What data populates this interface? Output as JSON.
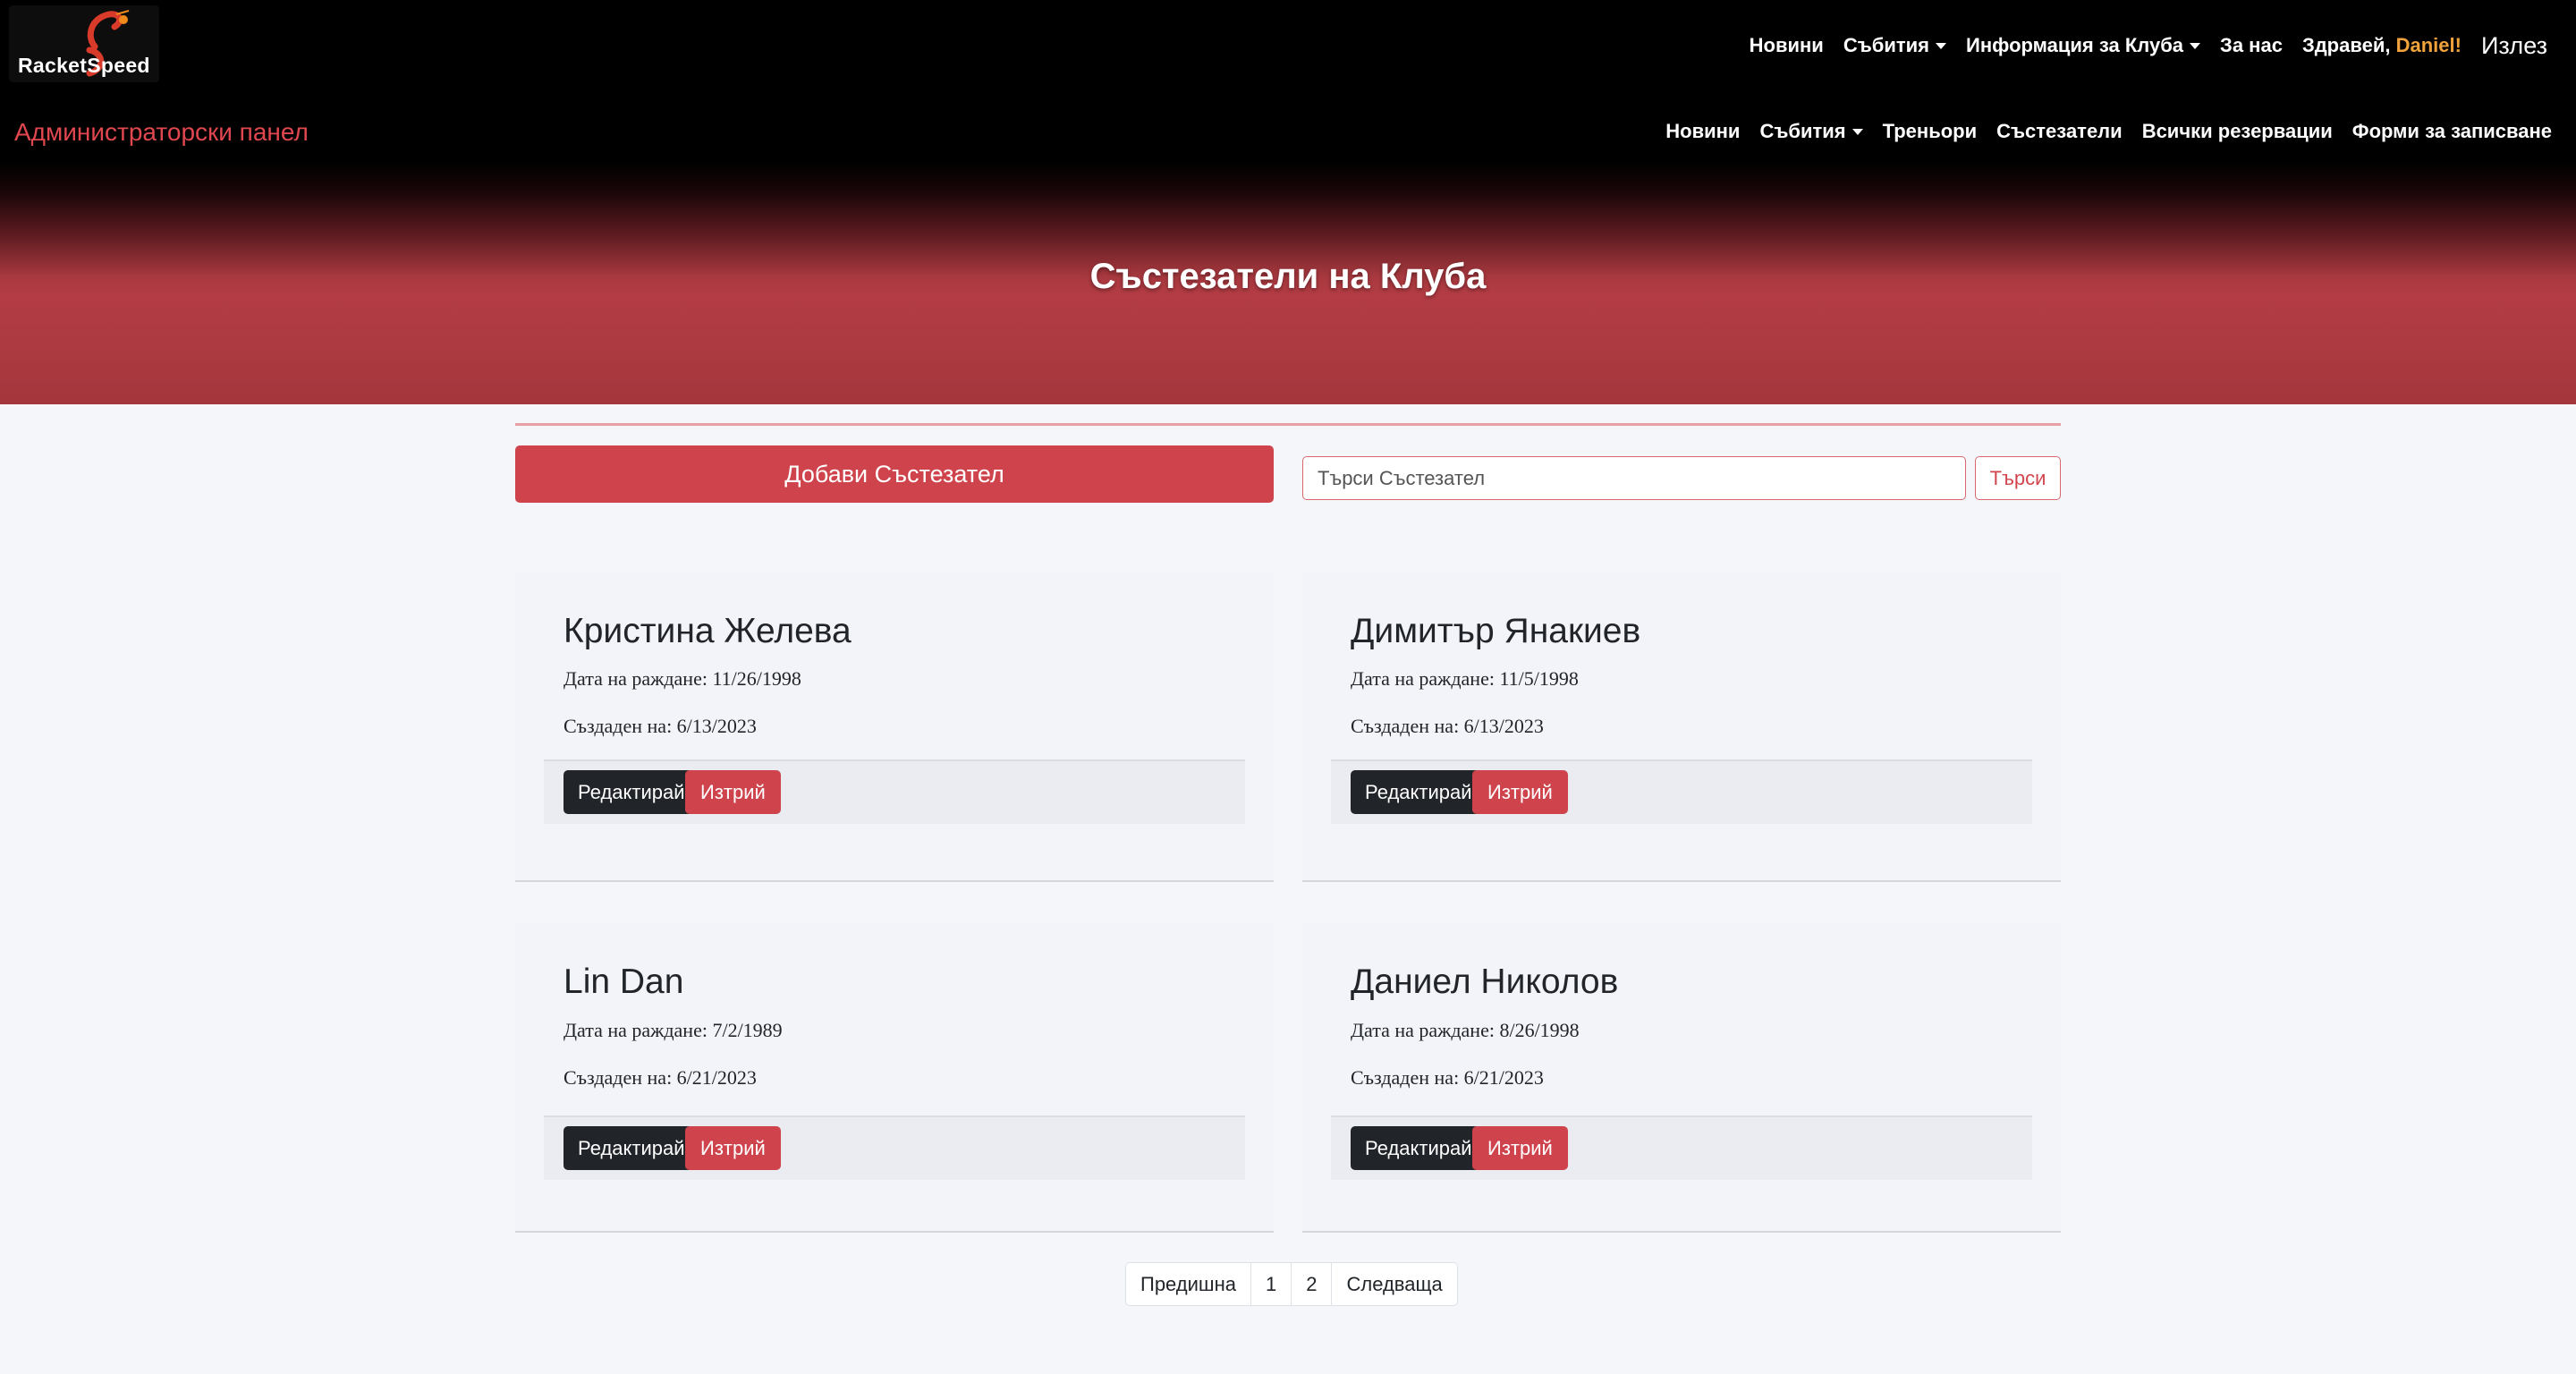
{
  "brand": {
    "logo_text": "RacketSpeed"
  },
  "topnav": {
    "items": [
      "Новини",
      "Събития",
      "Информация за Клуба",
      "За нас"
    ],
    "greeting": "Здравей,",
    "username": "Daniel!",
    "logout": "Излез"
  },
  "admin": {
    "title": "Администраторски панел",
    "nav": [
      "Новини",
      "Събития",
      "Треньори",
      "Състезатели",
      "Всички резервации",
      "Форми за записване"
    ]
  },
  "page": {
    "title": "Състезатели на Клуба"
  },
  "toolbar": {
    "add_label": "Добави Състезател",
    "search_placeholder": "Търси Състезател",
    "search_label": "Търси"
  },
  "players": [
    {
      "name": "Кристина Желева",
      "birth": "Дата на раждане: 11/26/1998",
      "created": "Създаден на: 6/13/2023"
    },
    {
      "name": "Димитър Янакиев",
      "birth": "Дата на раждане: 11/5/1998",
      "created": "Създаден на: 6/13/2023"
    },
    {
      "name": "Lin Dan",
      "birth": "Дата на раждане: 7/2/1989",
      "created": "Създаден на: 6/21/2023"
    },
    {
      "name": "Даниел Николов",
      "birth": "Дата на раждане: 8/26/1998",
      "created": "Създаден на: 6/21/2023"
    }
  ],
  "card_actions": {
    "edit": "Редактирай",
    "delete": "Изтрий"
  },
  "pagination": {
    "prev": "Предишна",
    "pages": [
      "1",
      "2"
    ],
    "next": "Следваща"
  },
  "colors": {
    "accent": "#cf444c",
    "dark": "#212529",
    "username": "#f0a23b"
  }
}
